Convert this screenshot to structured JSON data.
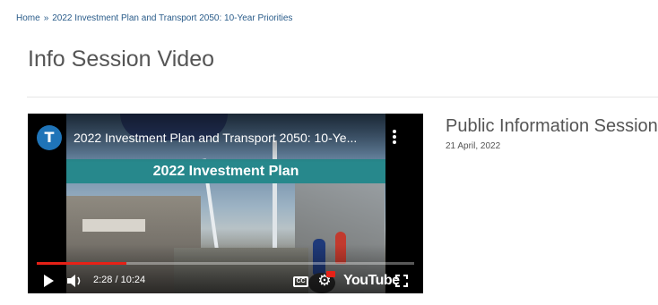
{
  "breadcrumb": {
    "items": [
      "Home",
      "2022 Investment Plan and Transport 2050: 10-Year Priorities"
    ],
    "separator": "»"
  },
  "page": {
    "title": "Info Session Video"
  },
  "video": {
    "channel_logo_letter": "T",
    "title": "2022 Investment Plan and Transport 2050: 10-Ye...",
    "banner_text": "2022 Investment Plan",
    "time_display": "2:28 / 10:24",
    "progress_fraction": 0.237,
    "cc_label": "CC",
    "youtube_label": "YouTube",
    "accent_color": "#e62117",
    "banner_color": "#27888c"
  },
  "session": {
    "title": "Public Information Session",
    "date": "21 April, 2022"
  },
  "icons": [
    "channel-logo",
    "more-options-icon",
    "play-icon",
    "volume-icon",
    "closed-captions-icon",
    "settings-icon",
    "youtube-logo",
    "fullscreen-icon"
  ]
}
